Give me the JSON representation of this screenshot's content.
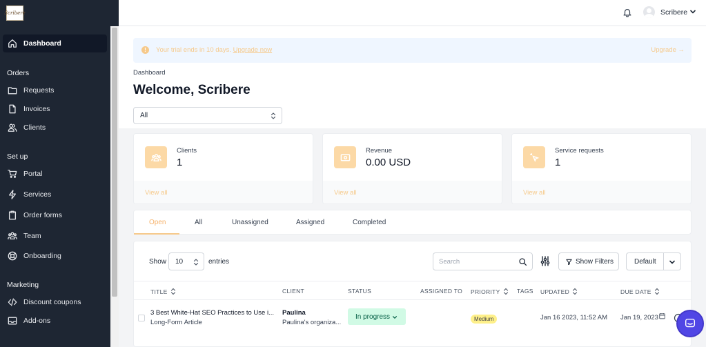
{
  "app": {
    "logo_text": "Scribere"
  },
  "sidebar": {
    "dashboard": "Dashboard",
    "sections": {
      "orders": "Orders",
      "setup": "Set up",
      "marketing": "Marketing"
    },
    "orders_items": [
      "Requests",
      "Invoices",
      "Clients"
    ],
    "setup_items": [
      "Portal",
      "Services",
      "Order forms",
      "Team",
      "Onboarding"
    ],
    "marketing_items": [
      "Discount coupons",
      "Add-ons"
    ]
  },
  "topbar": {
    "user_name": "Scribere"
  },
  "banner": {
    "text": "Your trial ends in 10 days.",
    "link": "Upgrade now",
    "upgrade": "Upgrade →"
  },
  "page": {
    "breadcrumb": "Dashboard",
    "title": "Welcome, Scribere",
    "filter_select": "All"
  },
  "cards": [
    {
      "label": "Clients",
      "value": "1",
      "link": "View all"
    },
    {
      "label": "Revenue",
      "value": "0.00 USD",
      "link": "View all"
    },
    {
      "label": "Service requests",
      "value": "1",
      "link": "View all"
    }
  ],
  "tabs": [
    "Open",
    "All",
    "Unassigned",
    "Assigned",
    "Completed"
  ],
  "table_controls": {
    "show": "Show",
    "entries_value": "10",
    "entries": "entries",
    "search_placeholder": "Search",
    "show_filters": "Show Filters",
    "sort_default": "Default"
  },
  "table": {
    "columns": [
      "TITLE",
      "CLIENT",
      "STATUS",
      "ASSIGNED TO",
      "PRIORITY",
      "TAGS",
      "UPDATED",
      "DUE DATE"
    ],
    "rows": [
      {
        "title": "3 Best White-Hat SEO Practices to Use i...",
        "subtitle": "Long-Form Article",
        "client": "Paulina",
        "client_org": "Paulina's organiza...",
        "status": "In progress",
        "assigned_to": "",
        "priority": "Medium",
        "tags": "",
        "updated": "Jan 16 2023, 11:52 AM",
        "due_date": "Jan 19, 2023"
      }
    ]
  },
  "colors": {
    "sidebar_bg": "#1e2633",
    "accent": "#f6c98a",
    "status_green": "#d1fae5",
    "priority_yellow": "#fef08a",
    "chat_purple": "#5046e5"
  }
}
